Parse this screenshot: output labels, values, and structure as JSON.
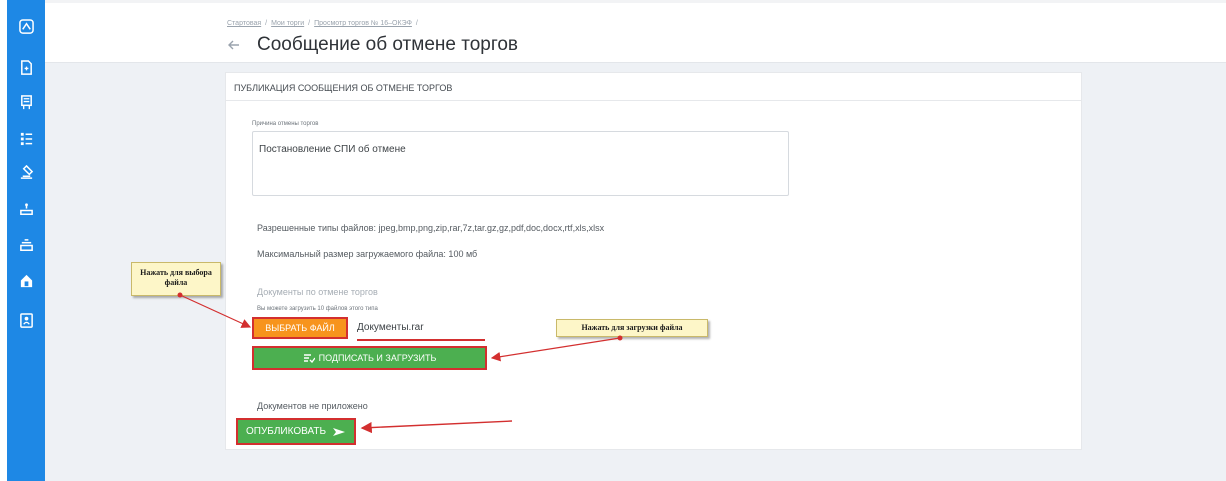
{
  "sidebar": {
    "icons": [
      "logo-icon",
      "document-icon",
      "certificate-icon",
      "list-icon",
      "gavel-icon",
      "auction-icon",
      "bidding-icon",
      "house-icon",
      "contact-card-icon"
    ],
    "color": "#1e88e5"
  },
  "header": {
    "breadcrumb": [
      "Стартовая",
      "Мои торги",
      "Просмотр торгов № 16–ОКЭФ"
    ],
    "title": "Сообщение об отмене торгов"
  },
  "panel": {
    "title": "ПУБЛИКАЦИЯ СООБЩЕНИЯ ОБ ОТМЕНЕ ТОРГОВ",
    "reason_label": "Причина отмены торгов",
    "reason_value": "Постановление СПИ об отмене",
    "allowed_types": "Разрешенные типы файлов: jpeg,bmp,png,zip,rar,7z,tar.gz,gz,pdf,doc,docx,rtf,xls,xlsx",
    "max_size": "Максимальный размер загружаемого файла: 100 мб",
    "docs_label": "Документы по отмене торгов",
    "docs_hint": "Вы можете загрузить 10 файлов этого типа",
    "choose_button": "ВЫБРАТЬ ФАЙЛ",
    "file_name": "Документы.rar",
    "upload_button": "ПОДПИСАТЬ И ЗАГРУЗИТЬ",
    "no_docs": "Документов не приложено",
    "publish_button": "ОПУБЛИКОВАТЬ"
  },
  "callouts": {
    "choose": "Нажать для выбора файла",
    "upload": "Нажать для загрузки файла"
  },
  "colors": {
    "accent_orange": "#f7941d",
    "accent_green": "#4caf50",
    "highlight_red": "#d32f2f"
  }
}
